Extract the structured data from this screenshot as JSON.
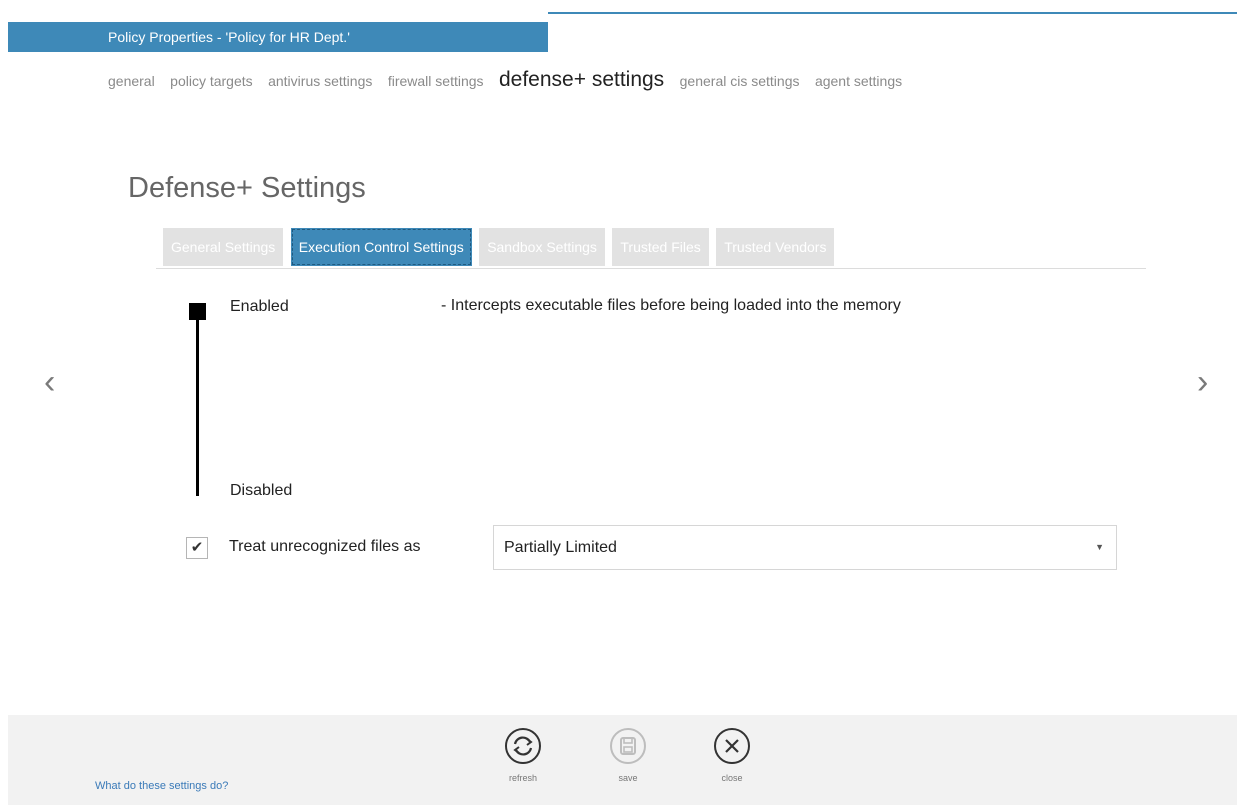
{
  "window": {
    "title": "Policy Properties - 'Policy for HR Dept.'"
  },
  "topnav": {
    "items": [
      "general",
      "policy targets",
      "antivirus settings",
      "firewall settings",
      "defense+ settings",
      "general cis settings",
      "agent settings"
    ],
    "active_index": 4
  },
  "page": {
    "title": "Defense+ Settings"
  },
  "subtabs": {
    "items": [
      "General Settings",
      "Execution Control Settings",
      "Sandbox Settings",
      "Trusted Files",
      "Trusted Vendors"
    ],
    "active_index": 1
  },
  "slider": {
    "top_label": "Enabled",
    "bottom_label": "Disabled",
    "current": "Enabled",
    "description": "- Intercepts executable files before being loaded into the memory"
  },
  "treat_unrecognized": {
    "checked": true,
    "label": "Treat unrecognized files as",
    "selected": "Partially Limited"
  },
  "nav": {
    "prev_icon": "chevron-left-icon",
    "next_icon": "chevron-right-icon",
    "prev_glyph": "‹",
    "next_glyph": "›"
  },
  "footer": {
    "help_link": "What do these settings do?",
    "buttons": [
      {
        "label": "refresh",
        "icon": "refresh-icon",
        "enabled": true
      },
      {
        "label": "save",
        "icon": "save-icon",
        "enabled": false
      },
      {
        "label": "close",
        "icon": "close-icon",
        "enabled": true
      }
    ]
  },
  "colors": {
    "accent": "#3e89b8",
    "tab_inactive": "#e2e2e2",
    "footer_bg": "#f2f2f2",
    "link": "#3a7ab8"
  }
}
